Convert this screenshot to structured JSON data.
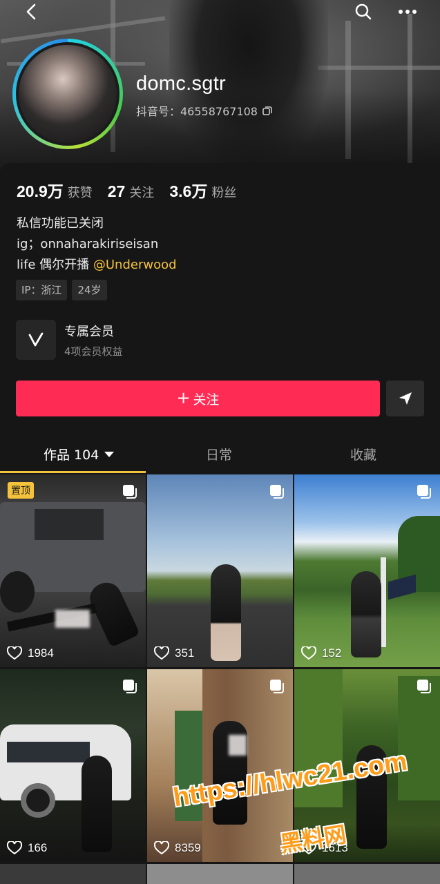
{
  "profile": {
    "username": "domc.sgtr",
    "douyin_id": "抖音号：46558767108",
    "stats": [
      {
        "num": "20.9万",
        "label": "获赞"
      },
      {
        "num": "27",
        "label": "关注"
      },
      {
        "num": "3.6万",
        "label": "粉丝"
      }
    ],
    "bio_line1": "私信功能已关闭",
    "bio_line2": "ig；onnaharakiriseisan",
    "bio_line3_prefix": "life 偶尔开播 ",
    "bio_line3_mention": "@Underwood",
    "tags": [
      "IP：浙江",
      "24岁"
    ],
    "membership": {
      "title": "专属会员",
      "subtitle": "4项会员权益"
    },
    "follow_label": "关注",
    "follow_plus": "+"
  },
  "tabs": {
    "works": "作品 104",
    "daily": "日常",
    "favorites": "收藏"
  },
  "grid": {
    "pin_label": "置顶",
    "items": [
      {
        "likes": "1984"
      },
      {
        "likes": "351"
      },
      {
        "likes": "152"
      },
      {
        "likes": "166"
      },
      {
        "likes": "8359"
      },
      {
        "likes": "1613"
      }
    ]
  },
  "watermark": {
    "line1": "https://hlwc21.com",
    "line2": "黑料网"
  },
  "colors": {
    "accent_red": "#fe2c55",
    "accent_yellow": "#f5c33b",
    "background": "#161616"
  },
  "icons": [
    "back-icon",
    "search-icon",
    "more-icon",
    "copy-icon",
    "membership-v-icon",
    "share-icon",
    "heart-icon",
    "multi-image-icon"
  ]
}
